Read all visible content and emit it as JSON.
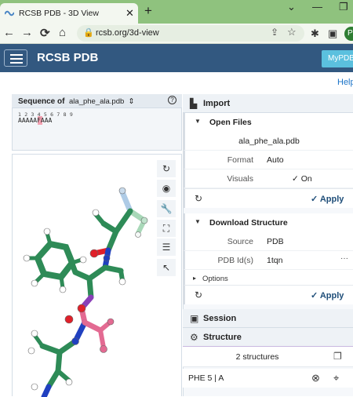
{
  "browser": {
    "tab_title": "RCSB PDB - 3D View",
    "url": "rcsb.org/3d-view",
    "profile_initial": "P",
    "controls": {
      "close_tab": "✕",
      "new_tab": "+",
      "minimize": "⌄",
      "restore": "❐",
      "back": "←",
      "forward": "→",
      "reload": "C",
      "home": "⌂",
      "lock": "🔒",
      "share": "⇪",
      "star": "☆",
      "extensions": "✱",
      "sidebar": "▣"
    }
  },
  "app": {
    "brand": "RCSB PDB",
    "mypdb_label": "MyPDB",
    "help_label": "Help",
    "menu_icon": "hamburger-icon"
  },
  "sequence": {
    "label": "Sequence of",
    "selected_file": "ala_phe_ala.pdb",
    "dropdown_caret": "⇕",
    "help_glyph": "?",
    "numbers": "1 2 3 4 5 6 7 8 9",
    "residues": "AAAAAFAAA"
  },
  "viewer_tools": [
    "reset-camera-icon",
    "screenshot-icon",
    "wrench-icon",
    "fullscreen-icon",
    "settings-icon",
    "selection-mode-icon"
  ],
  "viewer_tool_glyphs": [
    "↻",
    "◉",
    "🔧",
    "⛶",
    "☰",
    "↖"
  ],
  "import": {
    "title": "Import",
    "icon": "import-icon",
    "icon_glyph": "▙"
  },
  "open_files": {
    "title": "Open Files",
    "collapse_glyph": "▼",
    "file": "ala_phe_ala.pdb",
    "format_label": "Format",
    "format_value": "Auto",
    "visuals_label": "Visuals",
    "visuals_value": "✓ On",
    "apply_label": "✓ Apply",
    "refresh_glyph": "↻"
  },
  "download_structure": {
    "title": "Download Structure",
    "collapse_glyph": "▼",
    "source_label": "Source",
    "source_value": "PDB",
    "pdb_ids_label": "PDB Id(s)",
    "pdb_ids_value": "1tqn",
    "more_glyph": "···",
    "options_label": "Options",
    "options_glyph": "▸",
    "apply_label": "✓ Apply",
    "refresh_glyph": "↻"
  },
  "session": {
    "title": "Session",
    "icon": "session-icon",
    "icon_glyph": "▣"
  },
  "structure": {
    "title": "Structure",
    "icon": "gear-icon",
    "icon_glyph": "⚙",
    "count_label": "2 structures",
    "copy_glyph": "❐",
    "selection": "PHE 5 | A",
    "clear_glyph": "⊗",
    "focus_glyph": "⌖"
  },
  "colors": {
    "tabbar": "#8fc27e",
    "appbar": "#325880",
    "mypdb": "#5bc0de",
    "apply_text": "#1f4e79",
    "carbon": "#2e8b57",
    "oxygen": "#e0202a",
    "nitrogen": "#2040c0",
    "hydrogen": "#ffffff",
    "highlight_pink": "#e36a92",
    "highlight_purple": "#8a3fb8"
  }
}
